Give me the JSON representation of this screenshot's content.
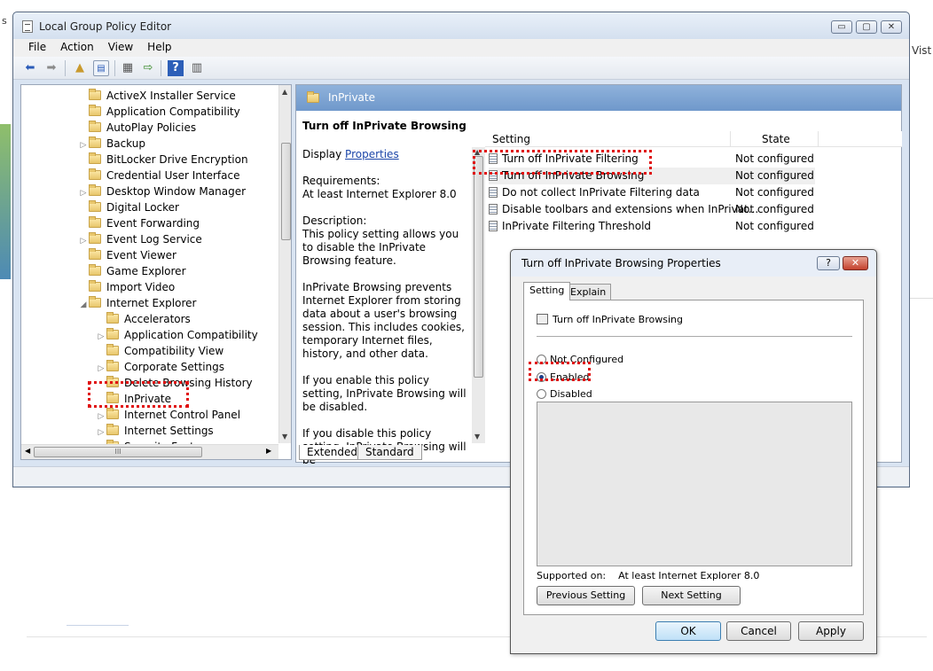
{
  "background": {
    "left_fragment": "s",
    "right_fragment": "Vist"
  },
  "window": {
    "title": "Local Group Policy Editor",
    "controls": {
      "minimize": "▭",
      "maximize": "▢",
      "close": "✕"
    },
    "menu": [
      "File",
      "Action",
      "View",
      "Help"
    ],
    "toolbar_icons": [
      "back-icon",
      "forward-icon",
      "up-folder-icon",
      "show-hide-tree-icon",
      "properties-icon",
      "export-list-icon",
      "help-icon",
      "filter-icon"
    ]
  },
  "tree": {
    "items": [
      {
        "label": "ActiveX Installer Service",
        "expandable": false
      },
      {
        "label": "Application Compatibility",
        "expandable": false
      },
      {
        "label": "AutoPlay Policies",
        "expandable": false
      },
      {
        "label": "Backup",
        "expandable": true
      },
      {
        "label": "BitLocker Drive Encryption",
        "expandable": false
      },
      {
        "label": "Credential User Interface",
        "expandable": false
      },
      {
        "label": "Desktop Window Manager",
        "expandable": true
      },
      {
        "label": "Digital Locker",
        "expandable": false
      },
      {
        "label": "Event Forwarding",
        "expandable": false
      },
      {
        "label": "Event Log Service",
        "expandable": true
      },
      {
        "label": "Event Viewer",
        "expandable": false
      },
      {
        "label": "Game Explorer",
        "expandable": false
      },
      {
        "label": "Import Video",
        "expandable": false
      },
      {
        "label": "Internet Explorer",
        "expandable": true,
        "expanded": true
      },
      {
        "label": "Accelerators",
        "expandable": false,
        "child": true
      },
      {
        "label": "Application Compatibility",
        "expandable": true,
        "child": true
      },
      {
        "label": "Compatibility View",
        "expandable": false,
        "child": true
      },
      {
        "label": "Corporate Settings",
        "expandable": true,
        "child": true
      },
      {
        "label": "Delete Browsing History",
        "expandable": false,
        "child": true
      },
      {
        "label": "InPrivate",
        "expandable": false,
        "child": true,
        "selected": true
      },
      {
        "label": "Internet Control Panel",
        "expandable": true,
        "child": true
      },
      {
        "label": "Internet Settings",
        "expandable": true,
        "child": true
      },
      {
        "label": "Security Features",
        "expandable": true,
        "child": true
      }
    ],
    "hscroll_grip": "III"
  },
  "right_pane": {
    "header": "InPrivate",
    "description": {
      "title": "Turn off InPrivate Browsing",
      "display_prefix": "Display ",
      "display_link": "Properties",
      "requirements_label": "Requirements:",
      "requirements_value": "At least Internet Explorer 8.0",
      "description_label": "Description:",
      "p1": "This policy setting allows you to disable the InPrivate Browsing feature.",
      "p2": "InPrivate Browsing prevents Internet Explorer from storing data about a user's browsing session. This includes cookies, temporary Internet files, history, and other data.",
      "p3": "If you enable this policy setting, InPrivate Browsing will be disabled.",
      "p4": "If you disable this policy setting, InPrivate Browsing will be"
    },
    "columns": {
      "setting": "Setting",
      "state": "State"
    },
    "rows": [
      {
        "setting": "Turn off InPrivate Filtering",
        "state": "Not configured"
      },
      {
        "setting": "Turn off InPrivate Browsing",
        "state": "Not configured"
      },
      {
        "setting": "Do not collect InPrivate Filtering data",
        "state": "Not configured"
      },
      {
        "setting": "Disable toolbars and extensions when InPrivat...",
        "state": "Not configured"
      },
      {
        "setting": "InPrivate Filtering Threshold",
        "state": "Not configured"
      }
    ],
    "tabs": [
      "Extended",
      "Standard"
    ]
  },
  "dialog": {
    "title": "Turn off InPrivate Browsing Properties",
    "help": "?",
    "close": "✕",
    "tabs": [
      "Setting",
      "Explain"
    ],
    "policy_name": "Turn off InPrivate Browsing",
    "options": [
      "Not Configured",
      "Enabled",
      "Disabled"
    ],
    "selected_option": "Enabled",
    "supported_label": "Supported on:",
    "supported_value": "At least Internet Explorer 8.0",
    "prev_button": "Previous Setting",
    "next_button": "Next Setting",
    "ok": "OK",
    "cancel": "Cancel",
    "apply": "Apply"
  },
  "colors": {
    "highlight": "#e01010",
    "header_blue": "#7ba1d2",
    "link": "#1c46a8"
  }
}
